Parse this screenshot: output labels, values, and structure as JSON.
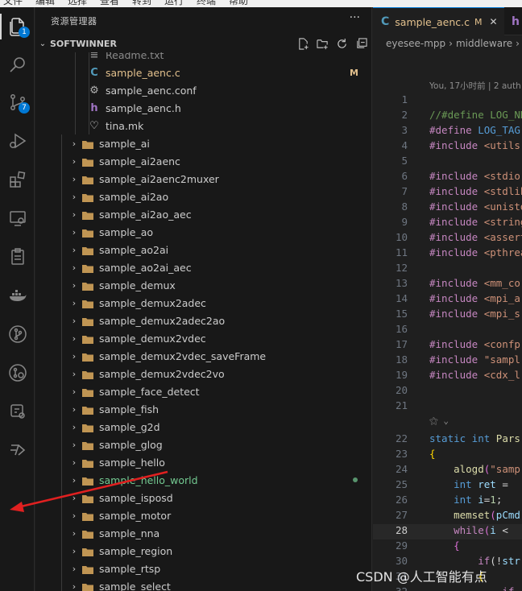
{
  "menubar": {
    "items": [
      "文件",
      "编辑",
      "选择",
      "查看",
      "转到",
      "运行",
      "终端",
      "帮助"
    ]
  },
  "activity": {
    "explorer_badge": "1",
    "scm_badge": "7"
  },
  "sidebar": {
    "title": "资源管理器",
    "more": "···",
    "section": "SOFTWINNER",
    "files": [
      {
        "name": "Readme.txt",
        "icon": "text-file-icon"
      },
      {
        "name": "sample_aenc.c",
        "icon": "c-file-icon",
        "status": "M"
      },
      {
        "name": "sample_aenc.conf",
        "icon": "gear-icon"
      },
      {
        "name": "sample_aenc.h",
        "icon": "h-file-icon"
      },
      {
        "name": "tina.mk",
        "icon": "heart-icon"
      }
    ],
    "folders": [
      "sample_ai",
      "sample_ai2aenc",
      "sample_ai2aenc2muxer",
      "sample_ai2ao",
      "sample_ai2ao_aec",
      "sample_ao",
      "sample_ao2ai",
      "sample_ao2ai_aec",
      "sample_demux",
      "sample_demux2adec",
      "sample_demux2adec2ao",
      "sample_demux2vdec",
      "sample_demux2vdec_saveFrame",
      "sample_demux2vdec2vo",
      "sample_face_detect",
      "sample_fish",
      "sample_g2d",
      "sample_glog",
      "sample_hello",
      "sample_hello_world",
      "sample_isposd",
      "sample_motor",
      "sample_nna",
      "sample_region",
      "sample_rtsp",
      "sample_select"
    ]
  },
  "editor": {
    "active_tab": "sample_aenc.c",
    "active_tab_status": "M",
    "breadcrumb": [
      "eyesee-mpp",
      "middleware"
    ],
    "blame": "You, 17小时前 | 2 auth",
    "current_line": 28
  },
  "watermark": "CSDN @人工智能有点",
  "colors": {
    "modified": "#e2c08d",
    "untracked": "#73c991",
    "accent": "#0078d4",
    "annotation_arrow": "#e02020"
  }
}
